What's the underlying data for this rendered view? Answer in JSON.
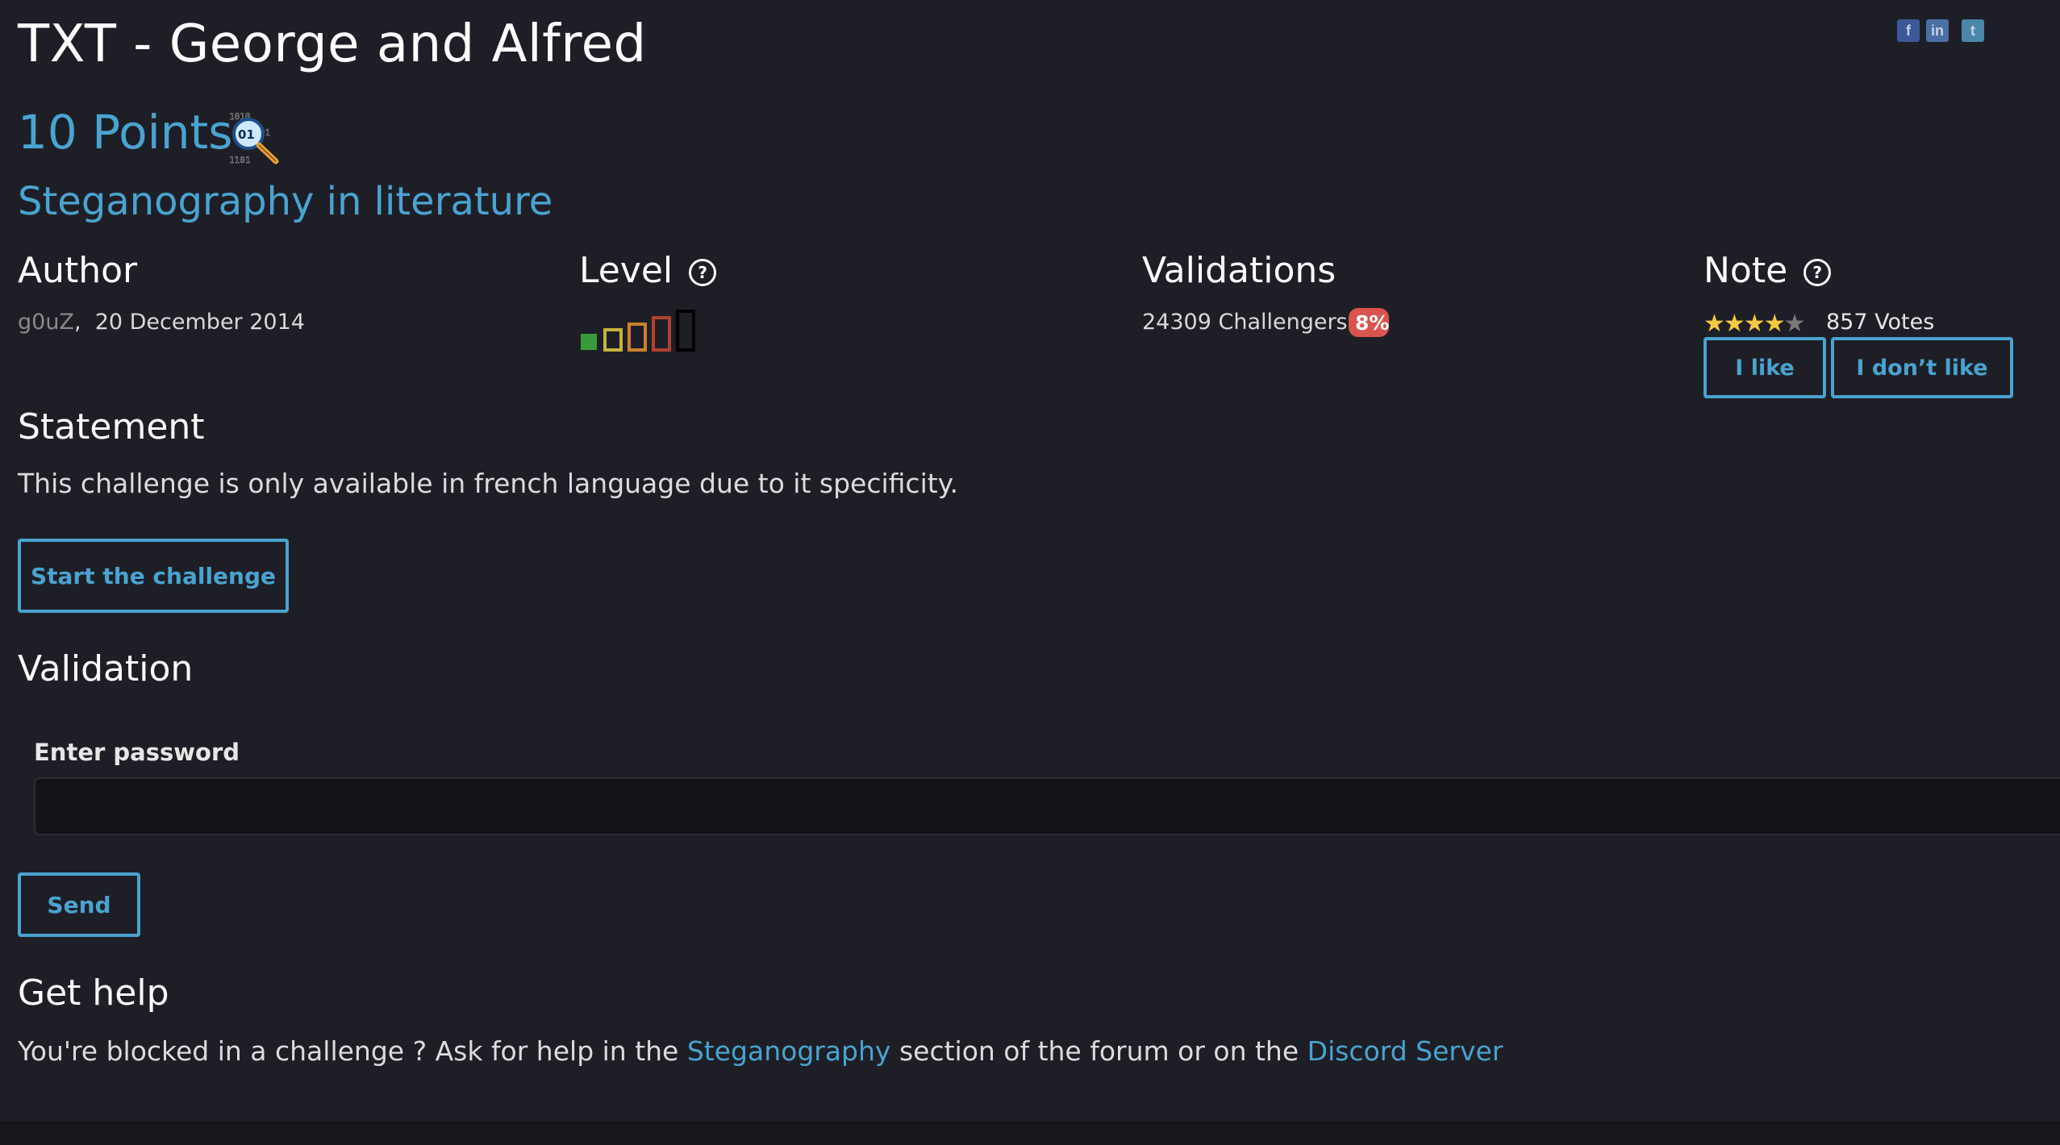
{
  "challenge": {
    "title": "TXT - George and Alfred",
    "points": "10 Points",
    "category": "Steganography in literature",
    "category_icon": "magnifier-binary-icon"
  },
  "social": [
    "facebook-icon",
    "linkedin-icon",
    "twitter-icon"
  ],
  "author": {
    "heading": "Author",
    "name": "g0uZ",
    "separator": ",",
    "date": "20 December 2014"
  },
  "level": {
    "heading": "Level",
    "help_glyph": "?",
    "current": 1,
    "max": 5,
    "colors": [
      "#3a9a3a",
      "#c9b23a",
      "#c9822f",
      "#b0412f",
      "#000000"
    ]
  },
  "validations": {
    "heading": "Validations",
    "challengers": "24309 Challengers",
    "percent_digit": "8",
    "percent_sign": "%"
  },
  "note": {
    "heading": "Note",
    "help_glyph": "?",
    "rating": 4,
    "max_rating": 5,
    "votes": "857 Votes",
    "like_label": "I like",
    "dislike_label": "I don’t like"
  },
  "statement": {
    "heading": "Statement",
    "text": "This challenge is only available in french language due to it specificity.",
    "start_label": "Start the challenge"
  },
  "validation": {
    "heading": "Validation",
    "password_label": "Enter password",
    "password_value": "",
    "send_label": "Send"
  },
  "get_help": {
    "heading": "Get help",
    "text_before": "You're blocked in a challenge ? Ask for help in the ",
    "link1": "Steganography",
    "text_middle": " section of the forum or on the ",
    "link2": "Discord Server"
  },
  "colors": {
    "background": "#1e1f26",
    "accent": "#4aa3d1",
    "badge": "#d9534f",
    "star": "#f5c842"
  }
}
